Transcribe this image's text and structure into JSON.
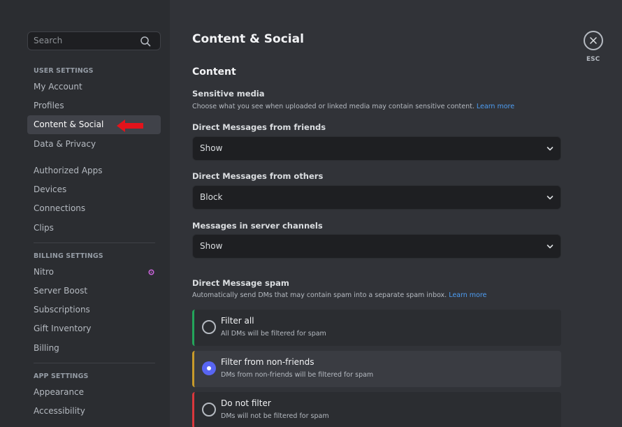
{
  "sidebar": {
    "search_placeholder": "Search",
    "user_settings": {
      "header": "USER SETTINGS",
      "items": [
        "My Account",
        "Profiles",
        "Content & Social",
        "Data & Privacy",
        "Authorized Apps",
        "Devices",
        "Connections",
        "Clips"
      ]
    },
    "billing_settings": {
      "header": "BILLING SETTINGS",
      "items": [
        "Nitro",
        "Server Boost",
        "Subscriptions",
        "Gift Inventory",
        "Billing"
      ]
    },
    "app_settings": {
      "header": "APP SETTINGS",
      "items": [
        "Appearance",
        "Accessibility"
      ]
    },
    "active_item": "Content & Social"
  },
  "main": {
    "title": "Content & Social",
    "section_title": "Content",
    "sensitive_media": {
      "label": "Sensitive media",
      "description": "Choose what you see when uploaded or linked media may contain sensitive content.",
      "link": "Learn more"
    },
    "dropdowns": [
      {
        "label": "Direct Messages from friends",
        "value": "Show"
      },
      {
        "label": "Direct Messages from others",
        "value": "Block"
      },
      {
        "label": "Messages in server channels",
        "value": "Show"
      }
    ],
    "dm_spam": {
      "label": "Direct Message spam",
      "description": "Automatically send DMs that may contain spam into a separate spam inbox.",
      "link": "Learn more",
      "options": [
        {
          "title": "Filter all",
          "description": "All DMs will be filtered for spam",
          "color": "#23a55a",
          "selected": false
        },
        {
          "title": "Filter from non-friends",
          "description": "DMs from non-friends will be filtered for spam",
          "color": "#c89a2a",
          "selected": true
        },
        {
          "title": "Do not filter",
          "description": "DMs will not be filtered for spam",
          "color": "#da373c",
          "selected": false
        }
      ]
    },
    "close": {
      "label": "ESC"
    }
  },
  "colors": {
    "accent": "#5865f2",
    "link": "#4e9ef4",
    "annotation_arrow": "#e3131b",
    "nitro_icon": "#c763d8"
  },
  "icons": {
    "search": "search-icon",
    "chevron": "chevron-down-icon",
    "close": "close-icon",
    "nitro": "nitro-icon",
    "annotation": "red-arrow"
  }
}
